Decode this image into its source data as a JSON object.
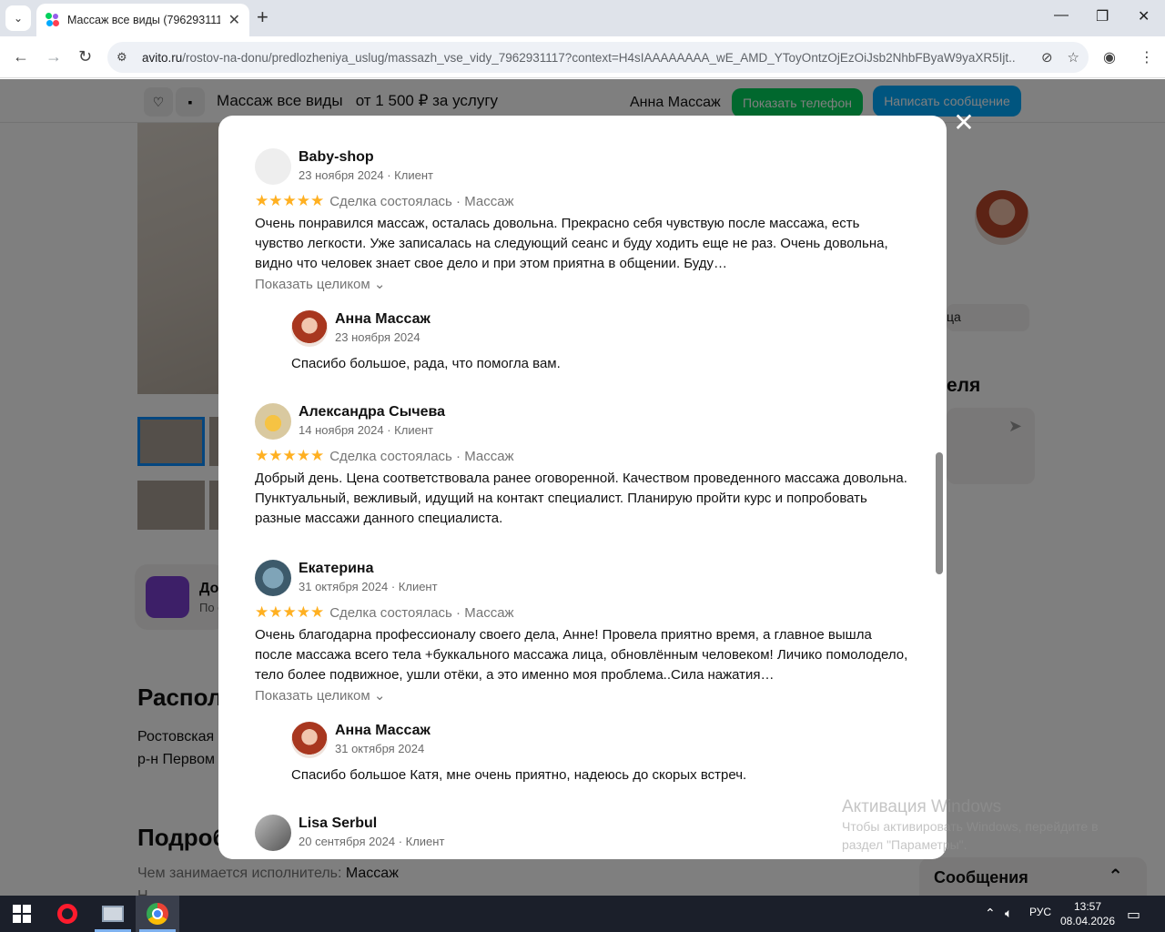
{
  "browser": {
    "tab_title": "Массаж все виды (7962931117",
    "url_host": "avito.ru",
    "url_rest": "/rostov-na-donu/predlozheniya_uslug/massazh_vse_vidy_7962931117?context=H4sIAAAAAAAA_wE_AMD_YToyOntzOjEzOiJsb2NhbFByaW9yaXR5Ijt..."
  },
  "sticky": {
    "title": "Массаж все виды",
    "price": "от 1 500 ₽ за услугу",
    "seller": "Анна Массаж",
    "show_phone": "Показать телефон",
    "write_message": "Написать сообщение"
  },
  "underlay": {
    "promo_title": "До",
    "promo_sub": "По с",
    "location_heading": "Распол",
    "location_line1": "Ростовская",
    "location_line2": "р-н Первом",
    "details_heading": "Подроб",
    "details_label": "Чем занимается исполнитель:",
    "details_value": "Массаж",
    "details_cut": "Н",
    "right_pill": "ца",
    "right_heading": "еля",
    "messages": "Сообщения"
  },
  "reviews": [
    {
      "name": "Baby-shop",
      "meta": "23 ноября 2024 · Клиент",
      "stars": "★★★★★",
      "deal": "Сделка состоялась · Массаж",
      "text": "Очень понравился массаж, осталась довольна. Прекрасно себя чувствую после массажа, есть чувство легкости. Уже записалась на следующий сеанс и буду ходить еще не раз. Очень довольна, видно что человек знает свое дело и при этом приятна в общении. Буду…",
      "show_more": "Показать целиком ⌄",
      "reply": {
        "name": "Анна Массаж",
        "date": "23 ноября 2024",
        "text": "Спасибо большое, рада, что помогла вам."
      }
    },
    {
      "name": "Александра Сычева",
      "meta": "14 ноября 2024 · Клиент",
      "stars": "★★★★★",
      "deal": "Сделка состоялась · Массаж",
      "text": "Добрый день. Цена соответствовала ранее оговоренной. Качеством проведенного массажа довольна. Пунктуальный, вежливый, идущий на контакт специалист. Планирую пройти курс и попробовать разные массажи данного специалиста."
    },
    {
      "name": "Екатерина",
      "meta": "31 октября 2024 · Клиент",
      "stars": "★★★★★",
      "deal": "Сделка состоялась · Массаж",
      "text": "Очень благодарна профессионалу своего дела, Анне! Провела приятно время, а главное вышла после массажа всего тела +буккального массажа лица, обновлённым человеком! Личико помолодело, тело более подвижное, ушли отёки, а это именно моя проблема..Сила нажатия…",
      "show_more": "Показать целиком ⌄",
      "reply": {
        "name": "Анна Массаж",
        "date": "31 октября 2024",
        "text": "Спасибо большое Катя, мне очень приятно, надеюсь до скорых встреч."
      }
    },
    {
      "name": "Lisa Serbul",
      "meta": "20 сентября 2024 · Клиент"
    }
  ],
  "watermark": {
    "line1": "Активация Windows",
    "line2": "Чтобы активировать Windows, перейдите в",
    "line3": "раздел \"Параметры\"."
  },
  "taskbar": {
    "lang": "РУС",
    "time": "13:57",
    "date": "08.04.2026"
  }
}
